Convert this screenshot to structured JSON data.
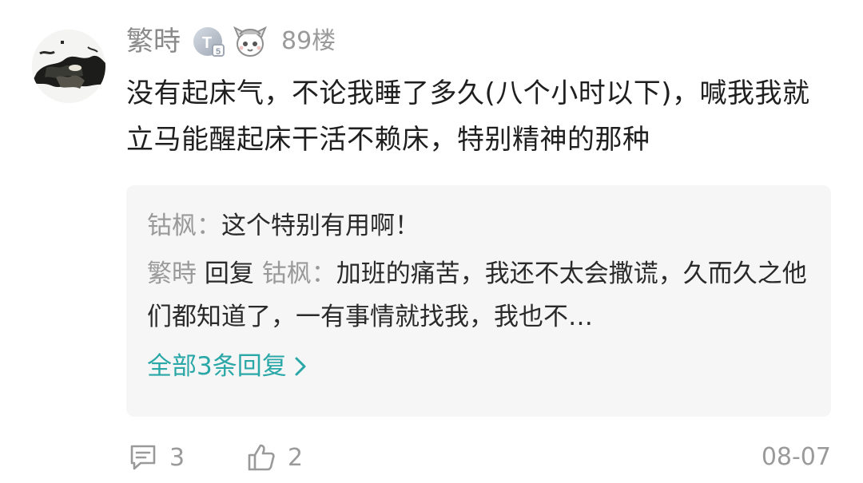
{
  "comment": {
    "username": "繁時",
    "level_badge_letter": "T",
    "level_badge_sub": "5",
    "floor": "89楼",
    "text": "没有起床气，不论我睡了多久(八个小时以下)，喊我我就立马能醒起床干活不赖床，特别精神的那种",
    "icons": {
      "avatar": "avatar-image",
      "level": "level-badge-icon",
      "mascot": "mascot-badge-icon"
    }
  },
  "replies": [
    {
      "user": "钴枫",
      "colon": "：",
      "text": "这个特别有用啊！"
    },
    {
      "user": "繁時",
      "verb": "回复",
      "target": "钴枫",
      "colon": "：",
      "text": "加班的痛苦，我还不太会撒谎，久而久之他们都知道了，一有事情就找我，我也不…"
    }
  ],
  "more_replies": {
    "label": "全部3条回复",
    "icon": "chevron-right-icon"
  },
  "footer": {
    "comment_count": "3",
    "like_count": "2",
    "date": "08-07",
    "icons": {
      "comment": "comment-icon",
      "like": "thumbs-up-icon"
    }
  },
  "colors": {
    "accent": "#2aa7a7",
    "muted": "#9a9a9a",
    "reply_bg": "#f6f6f6"
  }
}
